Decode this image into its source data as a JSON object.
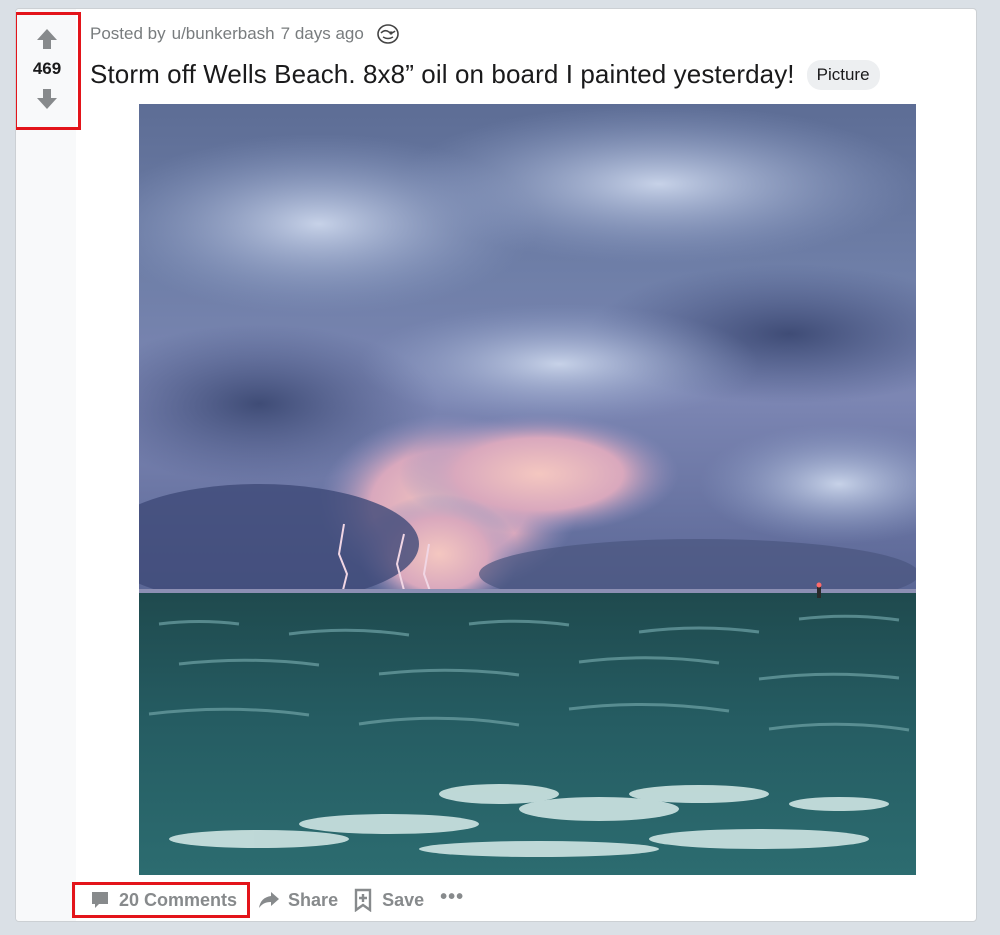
{
  "post": {
    "meta_prefix": "Posted by",
    "author": "u/bunkerbash",
    "time_ago": "7 days ago",
    "title": "Storm off Wells Beach. 8x8” oil on board I painted yesterday!",
    "flair": "Picture",
    "score": "469"
  },
  "actions": {
    "comments": "20 Comments",
    "share": "Share",
    "save": "Save",
    "more": "•••"
  },
  "icons": {
    "upvote": "arrow-up-icon",
    "downvote": "arrow-down-icon",
    "award": "award-icon",
    "comment": "comment-icon",
    "share": "share-icon",
    "save": "bookmark-plus-icon"
  },
  "colors": {
    "highlight_box": "#e3141a",
    "meta_text": "#787c7e",
    "action_text": "#878a8c"
  }
}
